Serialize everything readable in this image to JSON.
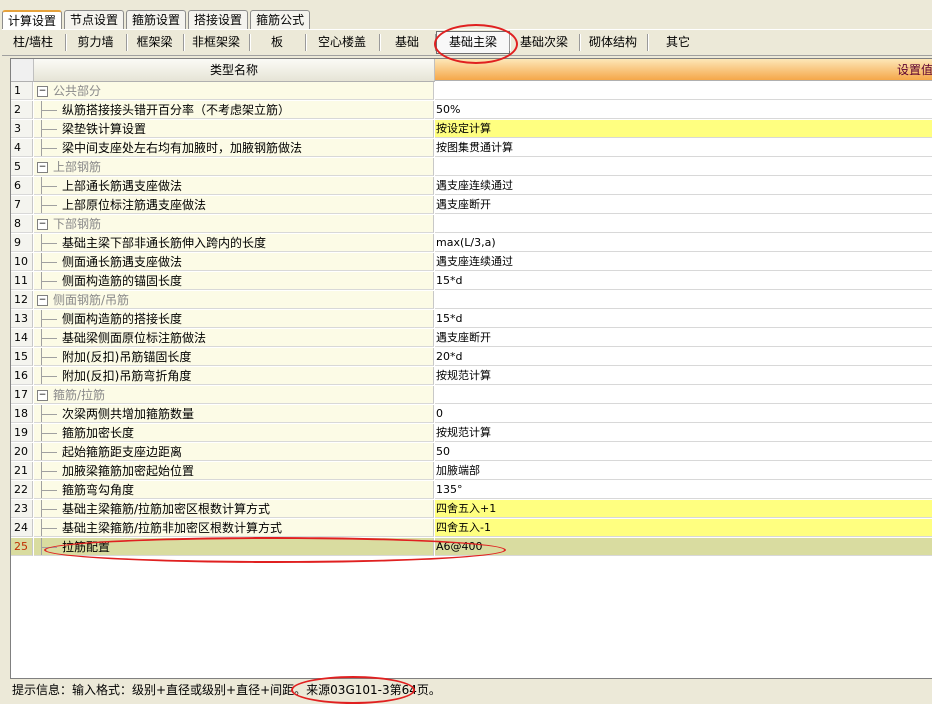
{
  "top_tabs": [
    "计算设置",
    "节点设置",
    "箍筋设置",
    "搭接设置",
    "箍筋公式"
  ],
  "sub_tabs": [
    "柱/墙柱",
    "剪力墙",
    "框架梁",
    "非框架梁",
    "板",
    "空心楼盖",
    "基础",
    "基础主梁",
    "基础次梁",
    "砌体结构",
    "其它"
  ],
  "active_sub_tab": "基础主梁",
  "grid": {
    "col_name": "类型名称",
    "col_value": "设置值",
    "rows": [
      {
        "n": "1",
        "group": true,
        "name": "公共部分",
        "value": ""
      },
      {
        "n": "2",
        "name": "纵筋搭接接头错开百分率（不考虑架立筋）",
        "value": "50%"
      },
      {
        "n": "3",
        "name": "梁垫铁计算设置",
        "value": "按设定计算",
        "yellow": true
      },
      {
        "n": "4",
        "name": "梁中间支座处左右均有加腋时，加腋钢筋做法",
        "value": "按图集贯通计算"
      },
      {
        "n": "5",
        "group": true,
        "name": "上部钢筋",
        "value": ""
      },
      {
        "n": "6",
        "name": "上部通长筋遇支座做法",
        "value": "遇支座连续通过"
      },
      {
        "n": "7",
        "name": "上部原位标注筋遇支座做法",
        "value": "遇支座断开"
      },
      {
        "n": "8",
        "group": true,
        "name": "下部钢筋",
        "value": ""
      },
      {
        "n": "9",
        "name": "基础主梁下部非通长筋伸入跨内的长度",
        "value": "max(L/3,a)"
      },
      {
        "n": "10",
        "name": "侧面通长筋遇支座做法",
        "value": "遇支座连续通过"
      },
      {
        "n": "11",
        "name": "侧面构造筋的锚固长度",
        "value": "15*d"
      },
      {
        "n": "12",
        "group": true,
        "name": "侧面钢筋/吊筋",
        "value": ""
      },
      {
        "n": "13",
        "name": "侧面构造筋的搭接长度",
        "value": "15*d"
      },
      {
        "n": "14",
        "name": "基础梁侧面原位标注筋做法",
        "value": "遇支座断开"
      },
      {
        "n": "15",
        "name": "附加(反扣)吊筋锚固长度",
        "value": "20*d"
      },
      {
        "n": "16",
        "name": "附加(反扣)吊筋弯折角度",
        "value": "按规范计算"
      },
      {
        "n": "17",
        "group": true,
        "name": "箍筋/拉筋",
        "value": ""
      },
      {
        "n": "18",
        "name": "次梁两侧共增加箍筋数量",
        "value": "0"
      },
      {
        "n": "19",
        "name": "箍筋加密长度",
        "value": "按规范计算"
      },
      {
        "n": "20",
        "name": "起始箍筋距支座边距离",
        "value": "50"
      },
      {
        "n": "21",
        "name": "加腋梁箍筋加密起始位置",
        "value": "加腋端部"
      },
      {
        "n": "22",
        "name": "箍筋弯勾角度",
        "value": "135°"
      },
      {
        "n": "23",
        "name": "基础主梁箍筋/拉筋加密区根数计算方式",
        "value": "四舍五入+1",
        "yellow": true
      },
      {
        "n": "24",
        "name": "基础主梁箍筋/拉筋非加密区根数计算方式",
        "value": "四舍五入-1",
        "yellow": true
      },
      {
        "n": "25",
        "name": "拉筋配置",
        "value": "A6@400",
        "selected": true
      }
    ]
  },
  "status": {
    "label": "提示信息：输入格式：级别+直径或级别+直径+间距。",
    "source": "来源03G101-3第64页。"
  },
  "colors": {
    "annotation": "#e02020",
    "header_value": "#f5a74a",
    "highlight": "#ffff80"
  }
}
